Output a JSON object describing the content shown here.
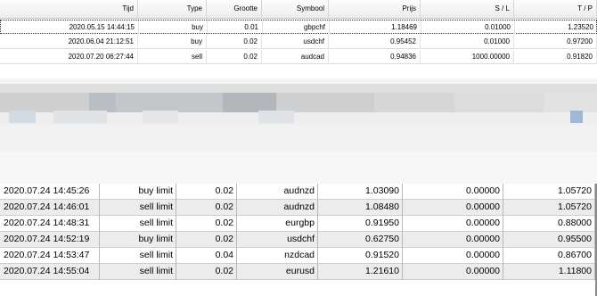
{
  "top_table": {
    "headers": [
      "Tijd",
      "Type",
      "Grootte",
      "Symbool",
      "Prijs",
      "S / L",
      "T / P"
    ],
    "rows": [
      [
        "2020.05.15 14:44:15",
        "buy",
        "0.01",
        "gbpchf",
        "1.18469",
        "0.01000",
        "1.23520"
      ],
      [
        "2020.06.04 21:12:51",
        "buy",
        "0.02",
        "usdchf",
        "0.95452",
        "0.01000",
        "0.97200"
      ],
      [
        "2020.07.20 06:27:44",
        "sell",
        "0.02",
        "audcad",
        "0.94836",
        "1000.00000",
        "0.91820"
      ]
    ]
  },
  "bottom_table": {
    "rows": [
      [
        "2020.07.24 14:45:26",
        "buy limit",
        "0.02",
        "audnzd",
        "1.03090",
        "0.00000",
        "1.05720"
      ],
      [
        "2020.07.24 14:46:01",
        "sell limit",
        "0.02",
        "audnzd",
        "1.08480",
        "0.00000",
        "1.05720"
      ],
      [
        "2020.07.24 14:48:31",
        "sell limit",
        "0.02",
        "eurgbp",
        "0.91950",
        "0.00000",
        "0.88000"
      ],
      [
        "2020.07.24 14:52:19",
        "buy limit",
        "0.02",
        "usdchf",
        "0.62750",
        "0.00000",
        "0.95500"
      ],
      [
        "2020.07.24 14:53:47",
        "sell limit",
        "0.04",
        "nzdcad",
        "0.91520",
        "0.00000",
        "0.86700"
      ],
      [
        "2020.07.24 14:55:04",
        "sell limit",
        "0.02",
        "eurusd",
        "1.21610",
        "0.00000",
        "1.11800"
      ]
    ]
  }
}
